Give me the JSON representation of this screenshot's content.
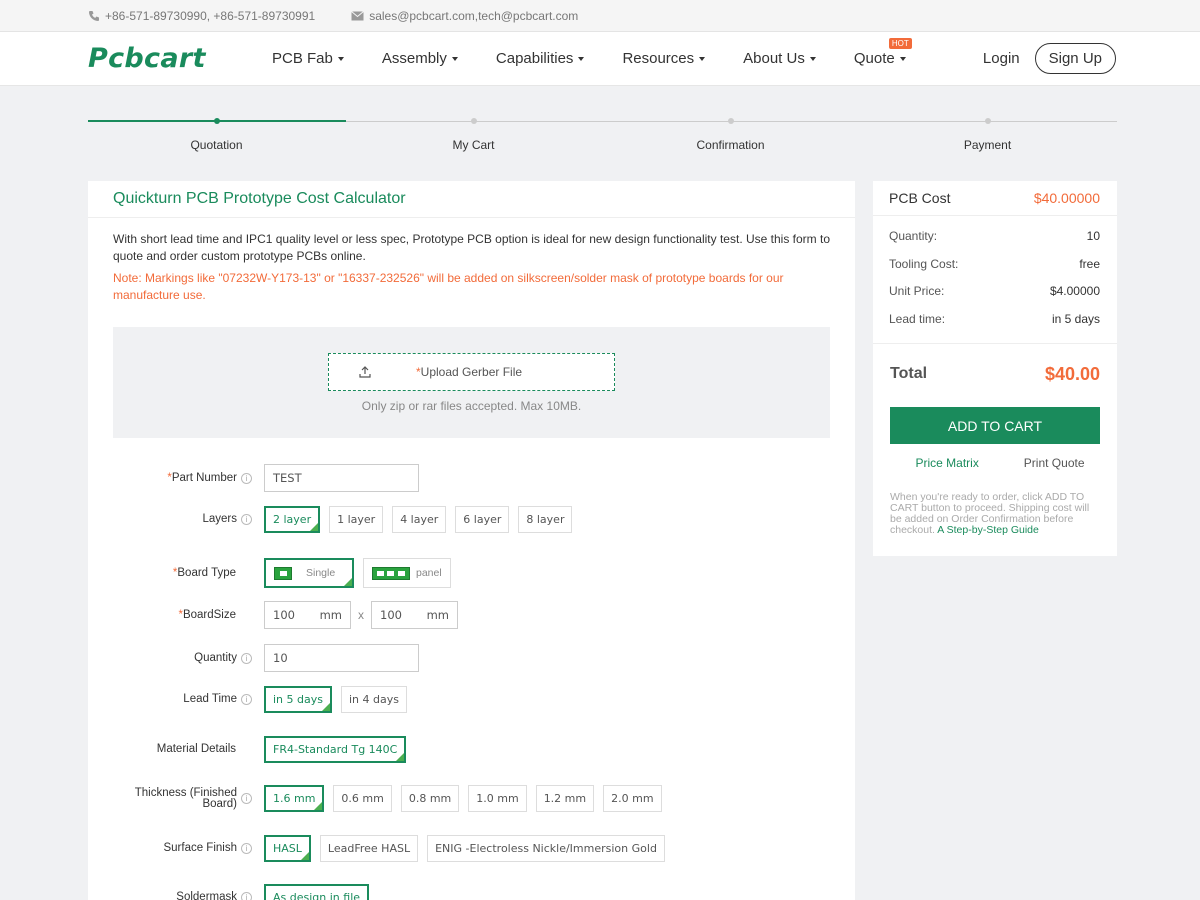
{
  "contact": {
    "phone": "+86-571-89730990, +86-571-89730991",
    "email": "sales@pcbcart.com,tech@pcbcart.com"
  },
  "nav": {
    "logo": "Pcbcart",
    "items": [
      "PCB Fab",
      "Assembly",
      "Capabilities",
      "Resources",
      "About Us",
      "Quote"
    ],
    "hot_badge": "HOT",
    "login": "Login",
    "signup": "Sign Up"
  },
  "progress": {
    "steps": [
      "Quotation",
      "My Cart",
      "Confirmation",
      "Payment"
    ],
    "active_index": 0
  },
  "calculator": {
    "title": "Quickturn PCB Prototype Cost Calculator",
    "description": "With short lead time and IPC1 quality level or less spec, Prototype PCB option is ideal for new design functionality test. Use this form to quote and order custom prototype PCBs online.",
    "note": "Note: Markings like \"07232W-Y173-13\" or \"16337-232526\" will be added on silkscreen/solder mask of prototype boards for our manufacture use.",
    "upload_label": "Upload Gerber File",
    "upload_required": "*",
    "upload_hint": "Only zip or rar files accepted. Max 10MB."
  },
  "form": {
    "part_number": {
      "label": "Part Number",
      "value": "TEST"
    },
    "layers": {
      "label": "Layers",
      "options": [
        "2 layer",
        "1 layer",
        "4 layer",
        "6 layer",
        "8 layer"
      ]
    },
    "board_type": {
      "label": "Board Type",
      "options": [
        "Single",
        "panel"
      ]
    },
    "board_size": {
      "label": "BoardSize",
      "width": "100",
      "height": "100",
      "unit": "mm",
      "sep": "x"
    },
    "quantity": {
      "label": "Quantity",
      "value": "10"
    },
    "lead_time": {
      "label": "Lead Time",
      "options": [
        "in 5 days",
        "in 4 days"
      ]
    },
    "material": {
      "label": "Material Details",
      "options": [
        "FR4-Standard Tg 140C"
      ]
    },
    "thickness": {
      "label_line1": "Thickness (Finished",
      "label_line2": "Board)",
      "options": [
        "1.6 mm",
        "0.6 mm",
        "0.8 mm",
        "1.0 mm",
        "1.2 mm",
        "2.0 mm"
      ]
    },
    "surface_finish": {
      "label": "Surface Finish",
      "options": [
        "HASL",
        "LeadFree HASL",
        "ENIG -Electroless Nickle/Immersion Gold"
      ]
    },
    "soldermask": {
      "label": "Soldermask",
      "options": [
        "As design in file"
      ]
    }
  },
  "summary": {
    "title": "PCB Cost",
    "cost": "$40.00000",
    "rows": [
      {
        "label": "Quantity:",
        "value": "10"
      },
      {
        "label": "Tooling Cost:",
        "value": "free"
      },
      {
        "label": "Unit Price:",
        "value": "$4.00000"
      },
      {
        "label": "Lead time:",
        "value": "in 5 days"
      }
    ],
    "total_label": "Total",
    "total_value": "$40.00",
    "add_to_cart": "ADD TO CART",
    "price_matrix": "Price Matrix",
    "print_quote": "Print Quote",
    "note": "When you're ready to order, click ADD TO CART button to proceed. Shipping cost will be added on Order Confirmation before checkout.",
    "guide_link": "A Step-by-Step Guide"
  },
  "colors": {
    "brand": "#1a8b5c",
    "accent": "#f26b3a"
  }
}
